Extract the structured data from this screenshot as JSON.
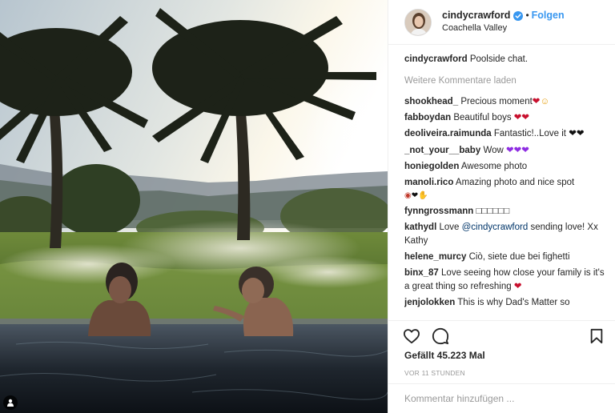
{
  "post": {
    "username": "cindycrawford",
    "follow_label": "Folgen",
    "separator": "•",
    "location": "Coachella Valley",
    "caption": {
      "user": "cindycrawford",
      "text": "Poolside chat."
    },
    "more_comments_label": "Weitere Kommentare laden",
    "comments": [
      {
        "user": "shookhead_",
        "text": "Precious moment",
        "emoji": "heart-and-smile"
      },
      {
        "user": "fabboydan",
        "text": "Beautiful boys",
        "emoji": "two-red-hearts"
      },
      {
        "user": "deoliveira.raimunda",
        "text": "Fantastic!..Love it",
        "emoji": "two-black-hearts"
      },
      {
        "user": "_not_your__baby",
        "text": "Wow",
        "emoji": "three-purple-hearts"
      },
      {
        "user": "honiegolden",
        "text": "Awesome photo"
      },
      {
        "user": "manoli.rico",
        "text": "Amazing photo and nice spot",
        "emoji": "camera-heart-hand"
      },
      {
        "user": "fynngrossmann",
        "text": "□□□□□□"
      },
      {
        "user": "kathydl",
        "text_before": "Love",
        "mention": "@cindycrawford",
        "text_after": "sending love! Xx Kathy"
      },
      {
        "user": "helene_murcy",
        "text": "Ciò, siete due bei fighetti"
      },
      {
        "user": "binx_87",
        "text": "Love seeing how close your family is it's a great thing so refreshing",
        "emoji": "heart"
      },
      {
        "user": "jenjolokken",
        "text": "This is why Dad's Matter so"
      }
    ],
    "likes_label": "Gefällt 45.223 Mal",
    "timestamp": "VOR 11 STUNDEN",
    "comment_placeholder": "Kommentar hinzufügen ..."
  },
  "colors": {
    "link_blue": "#3897f0",
    "verified_blue": "#3897f0",
    "muted_grey": "#999999",
    "heart_red": "#c8102e",
    "heart_purple": "#8e2de2"
  },
  "icons": {
    "verified": "verified-badge-icon",
    "like": "heart-outline-icon",
    "comment": "speech-bubble-icon",
    "save": "bookmark-icon",
    "user_tag": "person-tag-icon"
  }
}
